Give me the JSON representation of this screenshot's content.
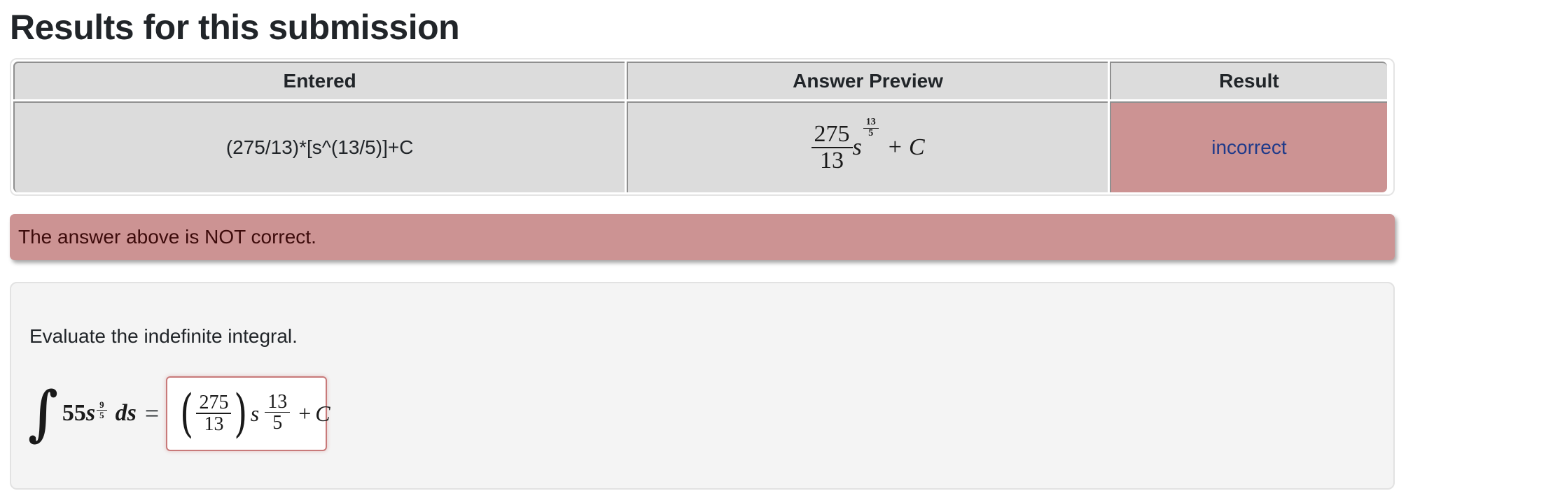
{
  "page": {
    "title": "Results for this submission"
  },
  "results_table": {
    "headers": [
      "Entered",
      "Answer Preview",
      "Result"
    ],
    "rows": [
      {
        "entered": "(275/13)*[s^(13/5)]+C",
        "preview": {
          "coef_num": "275",
          "coef_den": "13",
          "var": "s",
          "exp_num": "13",
          "exp_den": "5",
          "plus": "+",
          "const": "C"
        },
        "result": "incorrect"
      }
    ]
  },
  "alert": {
    "message": "The answer above is NOT correct.",
    "color": "#cc9393"
  },
  "problem": {
    "prompt": "Evaluate the indefinite integral.",
    "integrand": {
      "integral_symbol": "∫",
      "coefficient": "55",
      "var": "s",
      "exp_num": "9",
      "exp_den": "5",
      "differential": "ds",
      "equals": "="
    },
    "answer_field": {
      "open_paren": "(",
      "coef_num": "275",
      "coef_den": "13",
      "close_paren": ")",
      "var": "s",
      "exp_num": "13",
      "exp_den": "5",
      "plus": "+",
      "const": "C",
      "status": "incorrect"
    }
  },
  "colors": {
    "incorrect_bg": "#cc9393",
    "result_text": "#1f3a8a",
    "table_cell_bg": "#dcdcdc",
    "problem_bg": "#f4f4f4",
    "answer_border": "#c87a7a"
  }
}
